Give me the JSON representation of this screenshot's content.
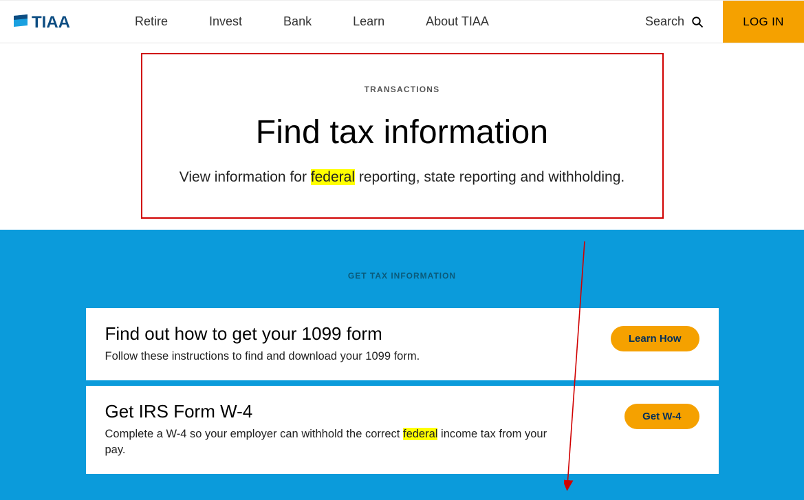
{
  "brand": "TIAA",
  "nav": {
    "items": [
      "Retire",
      "Invest",
      "Bank",
      "Learn",
      "About TIAA"
    ],
    "search_label": "Search",
    "login_label": "LOG IN"
  },
  "hero": {
    "eyebrow": "TRANSACTIONS",
    "title": "Find tax information",
    "sub_prefix": "View information for ",
    "sub_highlight": "federal",
    "sub_suffix": " reporting, state reporting and withholding."
  },
  "band": {
    "eyebrow": "GET TAX INFORMATION",
    "cards": [
      {
        "title": "Find out how to get your 1099 form",
        "desc_prefix": "Follow these instructions to find and download your 1099 form.",
        "desc_highlight": "",
        "desc_suffix": "",
        "button": "Learn How"
      },
      {
        "title": "Get IRS Form W-4",
        "desc_prefix": "Complete a W-4 so your employer can withhold the correct ",
        "desc_highlight": "federal",
        "desc_suffix": " income tax from your pay.",
        "button": "Get W-4"
      }
    ]
  },
  "colors": {
    "accent_orange": "#f5a100",
    "band_blue": "#0b9bdb",
    "callout_red": "#d00000",
    "highlight_yellow": "#ffff00"
  }
}
